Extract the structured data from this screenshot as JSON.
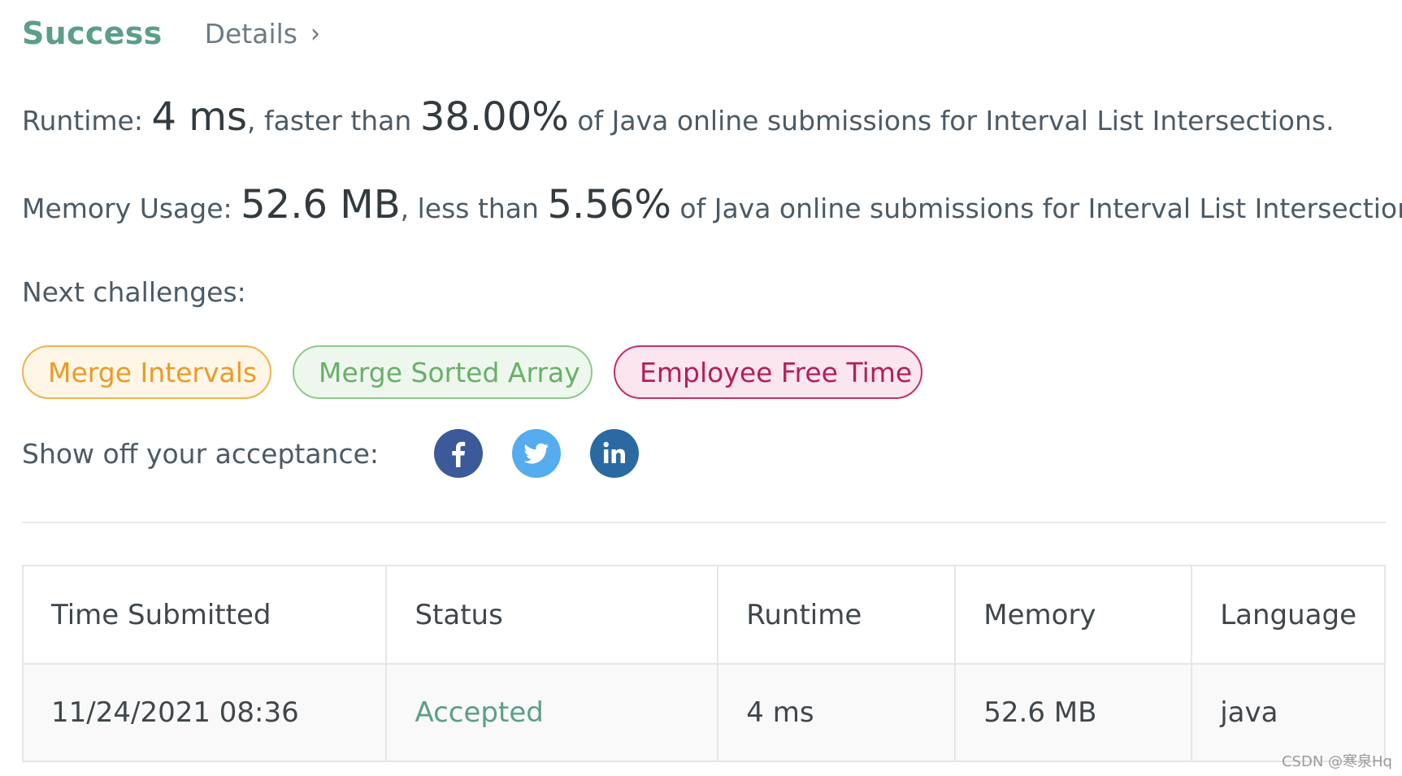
{
  "header": {
    "status": "Success",
    "details_label": "Details",
    "chevron": "›"
  },
  "runtime": {
    "label": "Runtime:",
    "value": "4 ms",
    "comparator": ", faster than ",
    "percent": "38.00%",
    "suffix": " of Java online submissions for Interval List Intersections."
  },
  "memory": {
    "label": "Memory Usage:",
    "value": "52.6 MB",
    "comparator": ", less than ",
    "percent": "5.56%",
    "suffix": " of Java online submissions for Interval List Intersections."
  },
  "next_challenges": {
    "label": "Next challenges:",
    "items": [
      {
        "label": "Merge Intervals",
        "color": "#ec9b25"
      },
      {
        "label": "Merge Sorted Array",
        "color": "#6aaf6a"
      },
      {
        "label": "Employee Free Time",
        "color": "#b31f5a"
      }
    ]
  },
  "share": {
    "label": "Show off your acceptance:",
    "icons": [
      "facebook-icon",
      "twitter-icon",
      "linkedin-icon"
    ]
  },
  "table": {
    "headers": [
      "Time Submitted",
      "Status",
      "Runtime",
      "Memory",
      "Language"
    ],
    "rows": [
      [
        "11/24/2021 08:36",
        "Accepted",
        "4 ms",
        "52.6 MB",
        "java"
      ]
    ]
  },
  "watermark": "CSDN @寒泉Hq",
  "colors": {
    "success": "#5b9e8a",
    "facebook": "#3c5a99",
    "twitter": "#55acee",
    "linkedin": "#2b69a3"
  }
}
